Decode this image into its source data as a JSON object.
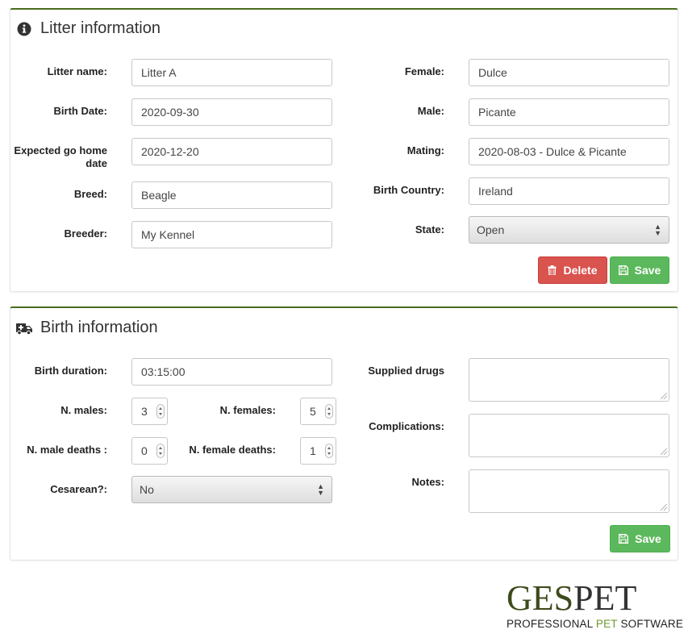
{
  "litter_panel": {
    "title": "Litter information",
    "title_icon": "info-circle-icon",
    "fields": {
      "litter_name": {
        "label": "Litter name:",
        "value": "Litter A"
      },
      "birth_date": {
        "label": "Birth Date:",
        "value": "2020-09-30"
      },
      "expected_go_home": {
        "label_line1": "Expected go home",
        "label_line2": "date",
        "value": "2020-12-20"
      },
      "breed": {
        "label": "Breed:",
        "value": "Beagle"
      },
      "breeder": {
        "label": "Breeder:",
        "value": "My Kennel"
      },
      "female": {
        "label": "Female:",
        "value": "Dulce"
      },
      "male": {
        "label": "Male:",
        "value": "Picante"
      },
      "mating": {
        "label": "Mating:",
        "value": "2020-08-03 - Dulce & Picante"
      },
      "birth_country": {
        "label": "Birth Country:",
        "value": "Ireland"
      },
      "state": {
        "label": "State:",
        "value": "Open"
      }
    },
    "buttons": {
      "delete": "Delete",
      "save": "Save"
    }
  },
  "birth_panel": {
    "title": "Birth information",
    "title_icon": "ambulance-icon",
    "fields": {
      "birth_duration": {
        "label": "Birth duration:",
        "value": "03:15:00"
      },
      "n_males": {
        "label": "N. males:",
        "value": "3"
      },
      "n_females": {
        "label": "N. females:",
        "value": "5"
      },
      "n_male_deaths": {
        "label": "N. male deaths :",
        "value": "0"
      },
      "n_female_deaths": {
        "label": "N. female deaths:",
        "value": "1"
      },
      "cesarean": {
        "label": "Cesarean?:",
        "value": "No"
      },
      "supplied_drugs": {
        "label": "Supplied drugs",
        "value": ""
      },
      "complications": {
        "label": "Complications:",
        "value": ""
      },
      "notes": {
        "label": "Notes:",
        "value": ""
      }
    },
    "buttons": {
      "save": "Save"
    }
  },
  "logo": {
    "ges": "GES",
    "pet": "PET",
    "sub_part1": "PROFESSIONAL ",
    "sub_accent": "PET",
    "sub_part2": " SOFTWARE"
  },
  "colors": {
    "panel_border_top": "#4a6b1f",
    "danger": "#d9534f",
    "success": "#5cb85c",
    "logo_green": "#6d9a2b"
  }
}
